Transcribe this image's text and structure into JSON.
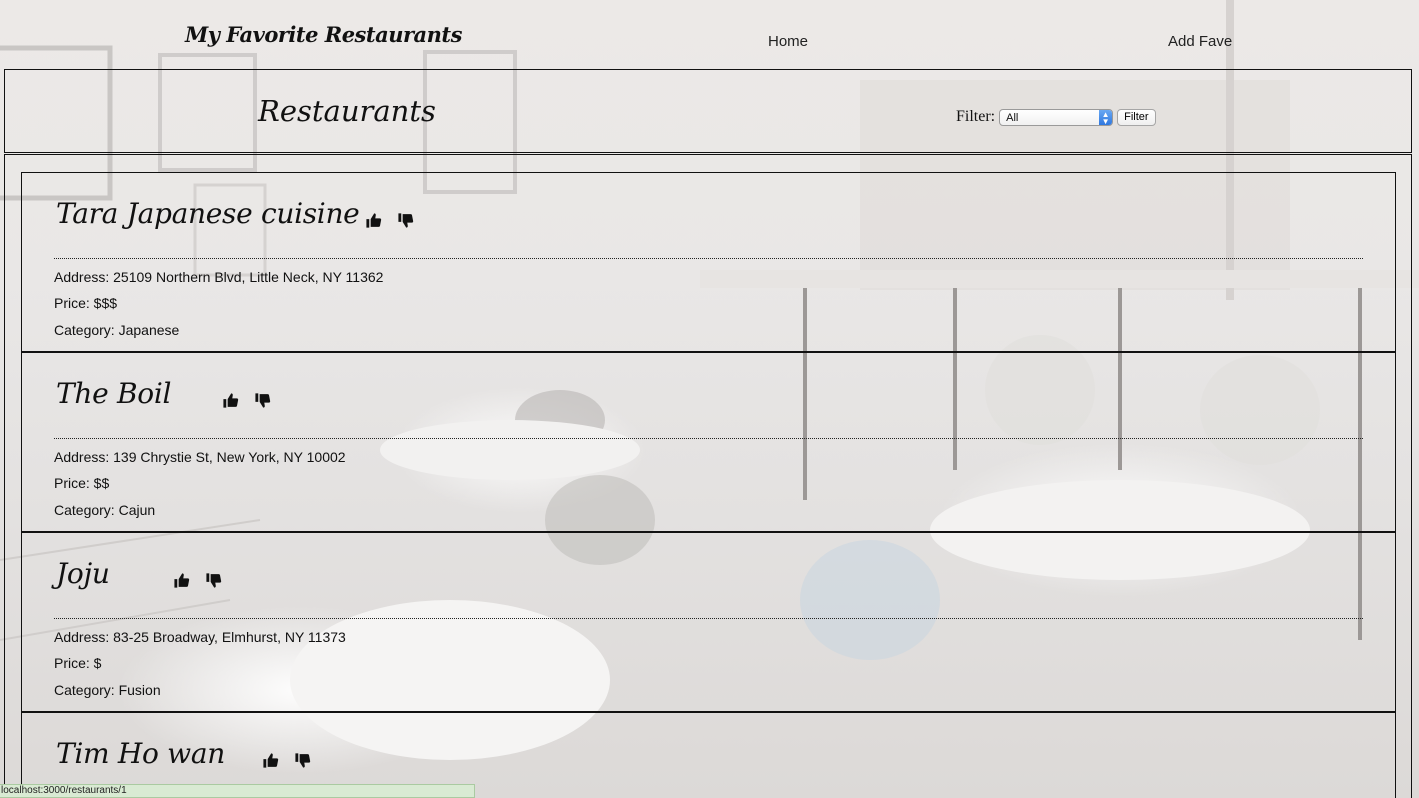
{
  "nav": {
    "brand": "My Favorite Restaurants",
    "home": "Home",
    "add_fave": "Add Fave"
  },
  "header": {
    "title": "Restaurants",
    "filter_label": "Filter:",
    "filter_selected": "All",
    "filter_button": "Filter"
  },
  "restaurants": [
    {
      "name": "Tara Japanese cuisine",
      "address": "Address: 25109 Northern Blvd, Little Neck, NY 11362",
      "price": "Price: $$$",
      "category": "Category: Japanese"
    },
    {
      "name": "The Boil",
      "address": "Address: 139 Chrystie St, New York, NY 10002",
      "price": "Price: $$",
      "category": "Category: Cajun"
    },
    {
      "name": "Joju",
      "address": "Address: 83-25 Broadway, Elmhurst, NY 11373",
      "price": "Price: $",
      "category": "Category: Fusion"
    },
    {
      "name": "Tim Ho wan",
      "address": "",
      "price": "",
      "category": ""
    }
  ],
  "icons": {
    "like": "thumbs-up-icon",
    "dislike": "thumbs-down-icon"
  },
  "status": {
    "url": "localhost:3000/restaurants/1"
  }
}
